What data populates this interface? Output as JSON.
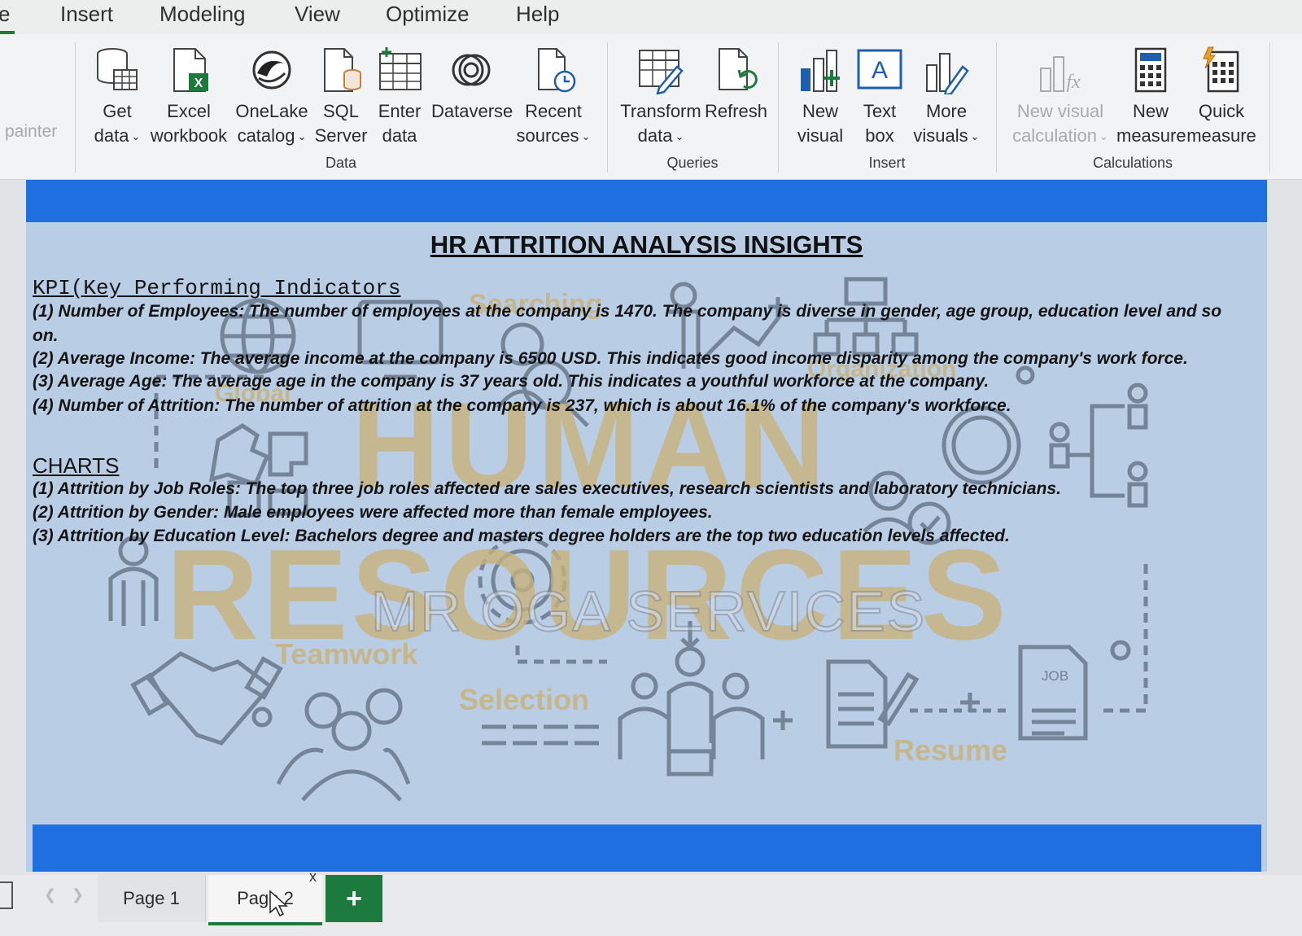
{
  "menu": {
    "items": [
      {
        "label": "e"
      },
      {
        "label": "Insert"
      },
      {
        "label": "Modeling"
      },
      {
        "label": "View"
      },
      {
        "label": "Optimize"
      },
      {
        "label": "Help"
      }
    ]
  },
  "ribbon": {
    "painter_label": "painter",
    "buttons": {
      "get_data": {
        "line1": "Get",
        "line2": "data"
      },
      "excel": {
        "line1": "Excel",
        "line2": "workbook"
      },
      "onelake": {
        "line1": "OneLake",
        "line2": "catalog"
      },
      "sql": {
        "line1": "SQL",
        "line2": "Server"
      },
      "enter": {
        "line1": "Enter",
        "line2": "data"
      },
      "dataverse": {
        "line1": "Dataverse"
      },
      "recent": {
        "line1": "Recent",
        "line2": "sources"
      },
      "transform": {
        "line1": "Transform",
        "line2": "data"
      },
      "refresh": {
        "line1": "Refresh"
      },
      "new_visual": {
        "line1": "New",
        "line2": "visual"
      },
      "text_box": {
        "line1": "Text",
        "line2": "box"
      },
      "more_visuals": {
        "line1": "More",
        "line2": "visuals"
      },
      "new_visual_calc": {
        "line1": "New visual",
        "line2": "calculation"
      },
      "new_measure": {
        "line1": "New",
        "line2": "measure"
      },
      "quick_measure": {
        "line1": "Quick",
        "line2": "measure"
      }
    },
    "groups": {
      "data": "Data",
      "queries": "Queries",
      "insert": "Insert",
      "calculations": "Calculations"
    }
  },
  "report": {
    "title": "HR ATTRITION ANALYSIS INSIGHTS",
    "kpi_heading": "KPI(Key Performing Indicators",
    "kpi_lines": [
      "(1) Number of Employees: The number of employees at the company is 1470. The company is diverse in gender, age group, education level and so",
      "on.",
      "(2) Average Income: The average income at the company is 6500 USD. This indicates good income disparity among the company's work force.",
      "(3) Average Age: The average age in the company is 37 years old. This indicates a youthful workforce at the company.",
      "(4) Number of Attrition: The number of attrition at the company is 237, which is about 16.1% of the company's workforce."
    ],
    "charts_heading": "CHARTS",
    "chart_lines": [
      "(1) Attrition by Job Roles: The top three job roles affected are sales executives, research scientists and laboratory technicians.",
      "(2) Attrition by Gender: Male employees were affected more than female employees.",
      "(3) Attrition by Education Level: Bachelors degree and masters degree holders are the top two education levels affected."
    ],
    "background": {
      "big_word_1": "HUMAN",
      "big_word_2": "RESOURCES",
      "overlay": "MR OGA SERVICES",
      "words": {
        "searching": "Searching",
        "global": "Global",
        "organization": "Organization",
        "teamwork": "Teamwork",
        "selection": "Selection",
        "resume": "Resume",
        "job": "JOB"
      }
    }
  },
  "pages": {
    "tabs": [
      {
        "label": "Page 1"
      },
      {
        "label": "Page 2"
      }
    ],
    "close": "x",
    "add": "+"
  },
  "colors": {
    "band_blue": "#1f6fe0",
    "page_bg": "#b9cde4",
    "watermark_gold": "#c9b37a",
    "icon_slate": "#5d6c80",
    "accent_green": "#1c7a3e"
  }
}
